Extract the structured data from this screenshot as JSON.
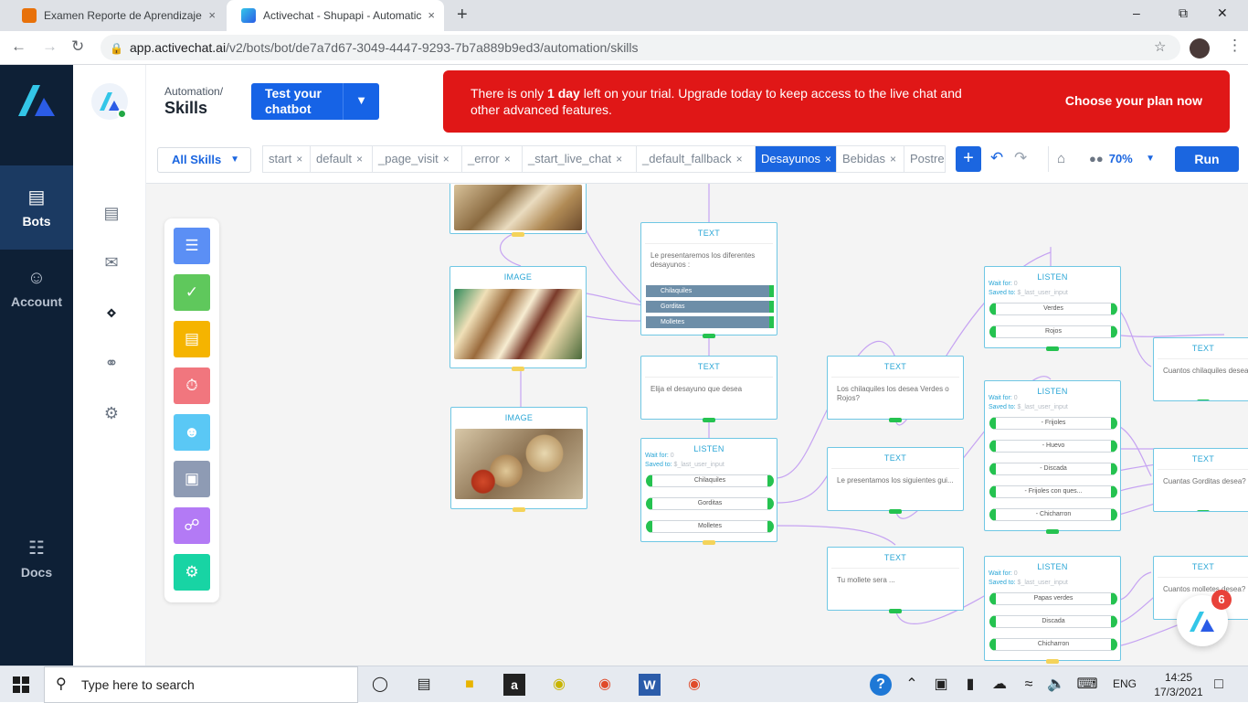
{
  "browser": {
    "tabs": [
      {
        "title": "Examen Reporte de Aprendizaje",
        "close": "×"
      },
      {
        "title": "Activechat - Shupapi - Automatic",
        "close": "×"
      }
    ],
    "new_tab": "+",
    "url_host": "app.activechat.ai",
    "url_path": "/v2/bots/bot/de7a7d67-3049-4447-9293-7b7a889b9ed3/automation/skills"
  },
  "leftnav": {
    "bots": "Bots",
    "account": "Account",
    "docs": "Docs"
  },
  "header": {
    "crumb": "Automation/",
    "title": "Skills",
    "test_button": "Test your chatbot",
    "trial_pre": "There is only ",
    "trial_bold": "1 day",
    "trial_post": " left on your trial. Upgrade today to keep access to the live chat and other advanced features.",
    "trial_cta": "Choose your plan now"
  },
  "toolbar": {
    "all_skills": "All Skills",
    "tabs": [
      "start",
      "default",
      "_page_visit",
      "_error",
      "_start_live_chat",
      "_default_fallback",
      "Desayunos",
      "Bebidas",
      "Postres"
    ],
    "active_tab": "Desayunos",
    "zoom": "70%",
    "run": "Run"
  },
  "canvas": {
    "image_label": "IMAGE",
    "text_label": "TEXT",
    "listen_label": "LISTEN",
    "wait_for": "Wait for:",
    "wait_val": "0",
    "saved_to": "Saved to:",
    "saved_val": "$_last_user_input",
    "text_intro": "Le presentaremos los diferentes desayunos :",
    "intro_buttons": [
      "Chilaquiles",
      "Gorditas",
      "Molletes"
    ],
    "text_choose": "Elija el desayuno que desea",
    "listen1_options": [
      "Chilaquiles",
      "Gorditas",
      "Molletes"
    ],
    "text_chilaquiles": "Los chilaquiles los desea Verdes o Rojos?",
    "text_gorditas": "Le presentamos los siguientes gui...",
    "text_mollete": "Tu mollete sera ...",
    "listen2_options": [
      "Verdes",
      "Rojos"
    ],
    "listen3_options": [
      "- Frijoles",
      "- Huevo",
      "- Discada",
      "- Frijoles con ques...",
      "- Chicharron"
    ],
    "listen4_options": [
      "Papas verdes",
      "Discada",
      "Chicharron"
    ],
    "text_q1": "Cuantos chilaquiles desea?",
    "text_q2": "Cuantas Gorditas desea?",
    "text_q3": "Cuantos molletes desea?"
  },
  "chat_badge": "6",
  "taskbar": {
    "search": "Type here to search",
    "lang": "ENG",
    "time": "14:25",
    "date": "17/3/2021"
  },
  "colors": {
    "nav_bg": "#0e2036",
    "accent": "#1b66e0",
    "trial_red": "#e01717",
    "node_border": "#6fc7e4",
    "handle_green": "#25c250"
  },
  "icons": [
    "search-icon",
    "lock-icon",
    "star-icon",
    "bots-icon",
    "account-icon",
    "docs-icon",
    "analytics-icon",
    "inbox-icon",
    "automation-icon",
    "integrations-icon",
    "settings-icon",
    "text-block-icon",
    "check-icon",
    "form-icon",
    "timer-icon",
    "user-icon",
    "code-icon",
    "cart-icon",
    "plugin-icon"
  ]
}
